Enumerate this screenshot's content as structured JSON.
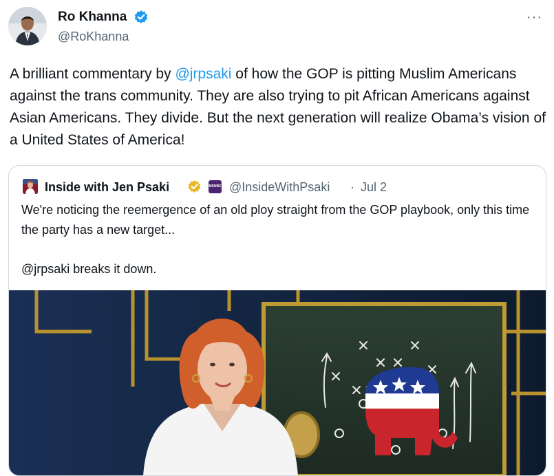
{
  "author": {
    "name": "Ro Khanna",
    "handle": "@RoKhanna"
  },
  "more_menu": "···",
  "tweet": {
    "text_before": "A brilliant commentary by ",
    "mention": "@jrpsaki",
    "text_after": " of how the GOP is pitting Muslim Americans against the trans community. They are also trying to pit African Americans against Asian Americans. They divide. But the next generation will realize Obama’s vision of a United States of America!"
  },
  "quoted": {
    "name": "Inside with Jen Psaki",
    "badge_text": "MSNBC",
    "handle": "@InsideWithPsaki",
    "separator": "·",
    "date": "Jul 2",
    "text": "We're noticing the reemergence of an old ploy straight from the GOP playbook, only this time the party has a new target...",
    "text_line3": "@jrpsaki breaks it down."
  },
  "icons": {
    "verified_color": "#1d9bf0",
    "gold_badge_color": "#e8b829",
    "mention_color": "#1d9bf0"
  }
}
